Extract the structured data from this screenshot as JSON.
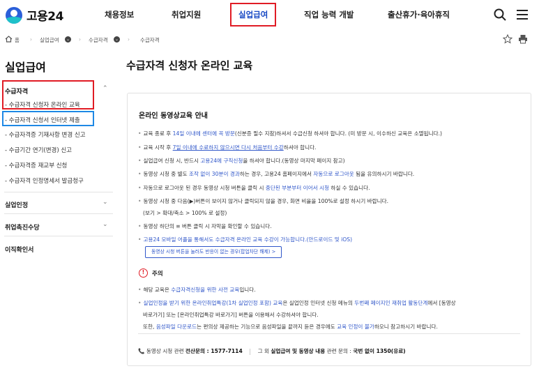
{
  "header": {
    "logo_text": "고용24",
    "nav": [
      "채용정보",
      "취업지원",
      "실업급여",
      "직업 능력 개발",
      "출산휴가·육아휴직"
    ]
  },
  "breadcrumb": {
    "home": "홈",
    "level1": "실업급여",
    "level2": "수급자격",
    "level3": "수급자격"
  },
  "sidebar": {
    "title": "실업급여",
    "sections": [
      {
        "label": "수급자격",
        "items": [
          "- 수급자격 신청자 온라인 교육",
          "- 수급자격 신청서 인터넷 제출",
          "- 수급자격증 기재사항 변경 신고",
          "- 수급기간 연기(변경) 신고",
          "- 수급자격증 재교부 신청",
          "- 수급자격 인정명세서 발급청구"
        ]
      },
      {
        "label": "실업인정"
      },
      {
        "label": "취업촉진수당"
      },
      {
        "label": "이직확인서"
      }
    ]
  },
  "main": {
    "title": "수급자격 신청자 온라인 교육",
    "panel_title": "온라인 동영상교육 안내",
    "l1": {
      "a": "교육 종료 후 ",
      "b": "14일 이내에 센터에 꼭 방문",
      "c": "(신분증 필수 지참)하셔서 수급신청 하셔야 합니다. (미 방문 시, 이수하신 교육은 소멸됩니다.)"
    },
    "l2": {
      "a": "교육 시작 후 ",
      "b": "7일 이내에 수료하지 않으시면 다시 처음부터 수강",
      "c": "하셔야 합니다."
    },
    "l3": {
      "a": "실업급여 신청 시, 반드시 ",
      "b": "고용24에 구직신청",
      "c": "을 하셔야 합니다.(동영상 마지막 페이지 참고)"
    },
    "l4": {
      "a": "동영상 시청 중 별도 ",
      "b": "조작 없이 30분이 경과",
      "c": "하는 경우, 고용24 홈페이지에서 ",
      "d": "자동으로 로그아웃",
      "e": " 됨을 유의하시기 바랍니다."
    },
    "l5": {
      "a": "자동으로 로그아웃 된 경우 동영상 시청 버튼을 클릭 시 ",
      "b": "중단된 부분부터 이어서 시청",
      "c": " 하실 수 있습니다."
    },
    "l6": "동영상 시청 중 다음(▶)버튼이 보이지 않거나 클릭되지 않을 경우, 화면 비율을 100%로 설정 하시기 바랍니다.",
    "l6b": "(보기 > 확대/축소 > 100% 로 설정)",
    "l7": "동영상 하단의 ≡ 버튼 클릭 시 자막을 확인할 수 있습니다.",
    "l8": "고용24 모바일 어플을 통해서도 수급자격 온라인 교육 수강이 가능합니다.(안드로이드 및 iOS)",
    "popup_button": "동영상 시청 버튼을 눌러도 반응이 없는 경우(팝업차단 해제) >",
    "warn_title": "주의",
    "w1": {
      "a": "해당 교육은 ",
      "b": "수급자격신청을 위한 사전 교육",
      "c": "입니다."
    },
    "w2": {
      "a": "실업인정을 받기 위한 온라인취업특강(1차 실업인정 포함) 교육",
      "b": "은 실업인정 인터넷 신청 메뉴의 ",
      "c": "두번째 페이지인 재취업 활동단계",
      "d": "에서 [동영상"
    },
    "w2b": "바로가기] 또는 [온라인취업특강 바로가기] 버튼을 이용해서 수강하셔야 합니다.",
    "w2c": {
      "a": "또한, ",
      "b": "음성파일 다운로드",
      "c": "는 편의상 제공하는 기능으로 음성파일을 끝까지 듣은 경우에도 ",
      "d": "교육 인정이 불가",
      "e": "하오니 참고하시기 바랍니다."
    },
    "contact": {
      "a": "동영상 시청 관련 ",
      "b": "전산문의 : 1577-7114",
      "c": "그 외 ",
      "d": "실업급여 및 동영상 내용",
      "e": " 관련 문의 : ",
      "f": "국번 없이 1350(유료)"
    }
  },
  "icons": [
    "home-icon",
    "search-icon",
    "menu-icon",
    "star-icon",
    "print-icon",
    "phone-icon",
    "chevron-down-icon"
  ],
  "colors": {
    "accent": "#2f56c9",
    "highlight_red": "#e01b24",
    "highlight_blue": "#1e88e5"
  }
}
